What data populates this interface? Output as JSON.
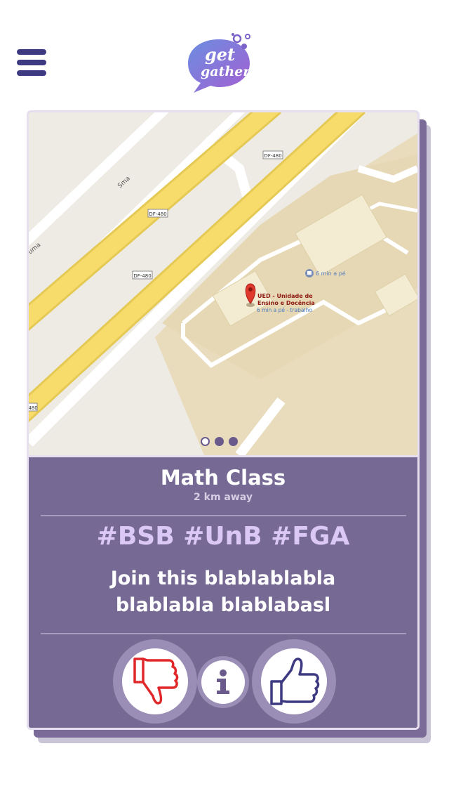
{
  "header": {
    "logo_line1": "get",
    "logo_line2": "gather"
  },
  "map": {
    "road_labels": [
      "Sma",
      "uma",
      "DF-480",
      "DF-480",
      "DF-480",
      "480"
    ],
    "place_name_line1": "UED - Unidade de",
    "place_name_line2": "Ensino e Docência",
    "place_walk": "6 min a pé - trabalho",
    "poi_walk": "6 min a pé",
    "pager": {
      "count": 3,
      "active_index": 0
    }
  },
  "event": {
    "title": "Math Class",
    "distance": "2 km away",
    "tags": "#BSB #UnB #FGA",
    "description_line1": "Join this blablablabla",
    "description_line2": "blablabla blablabasl"
  },
  "actions": {
    "dislike_icon": "thumbs-down-icon",
    "info_icon": "info-icon",
    "like_icon": "thumbs-up-icon"
  },
  "colors": {
    "primary": "#766a94",
    "nav": "#3e3a82",
    "hashtag": "#dcc8f6",
    "dislike": "#e0282a",
    "like": "#3e3a82"
  }
}
